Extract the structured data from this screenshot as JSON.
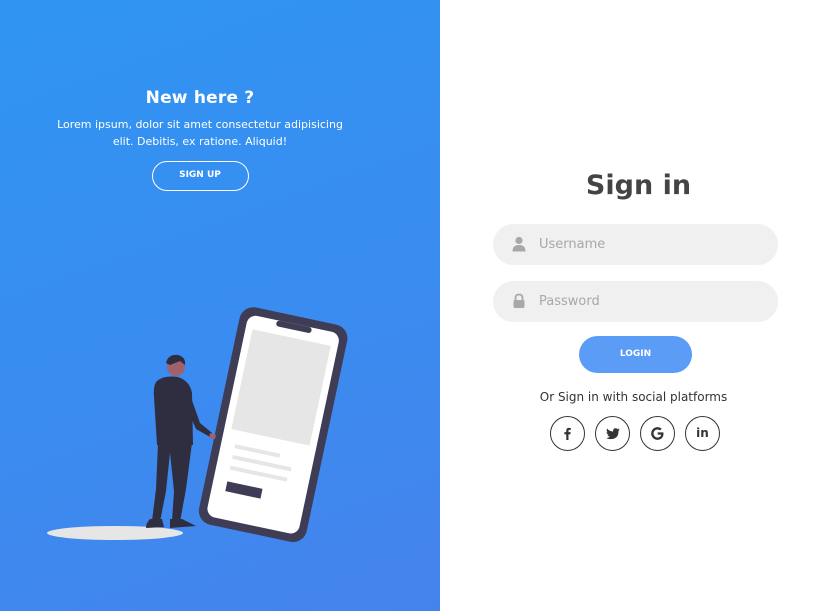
{
  "promo": {
    "title": "New here ?",
    "text": "Lorem ipsum, dolor sit amet consectetur adipisicing elit. Debitis, ex ratione. Aliquid!",
    "signup_label": "SIGN UP"
  },
  "signin": {
    "title": "Sign in",
    "username_placeholder": "Username",
    "password_placeholder": "Password",
    "login_label": "LOGIN",
    "social_text": "Or Sign in with social platforms"
  },
  "social": [
    {
      "icon": "facebook-icon",
      "glyph": "f"
    },
    {
      "icon": "twitter-icon",
      "glyph": "t"
    },
    {
      "icon": "google-icon",
      "glyph": "G"
    },
    {
      "icon": "linkedin-icon",
      "glyph": "in"
    }
  ],
  "colors": {
    "left_gradient_start": "#2f95f2",
    "left_gradient_end": "#4583ec",
    "accent": "#5a9cf6",
    "input_bg": "#f0f0f0",
    "title_text": "#444444"
  }
}
